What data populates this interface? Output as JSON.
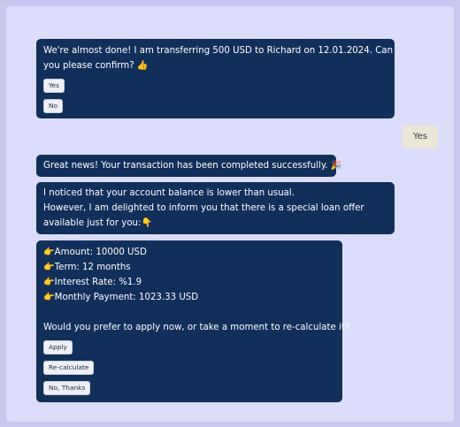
{
  "messages": {
    "m1": {
      "line1": "We're almost done! I am transferring 500 USD to Richard on 12.01.2024. Can",
      "line2": "you please confirm? 👍",
      "buttons": [
        "Yes",
        "No"
      ]
    },
    "user_reply": "Yes",
    "m2": {
      "text": "Great news! Your transaction has been completed successfully. 🎉"
    },
    "m3": {
      "line1": "I noticed that your account balance is lower than usual.",
      "line2": "However, I am delighted to inform you that there is a special loan offer",
      "line3": "available just for you:👇"
    },
    "m4": {
      "amount": "👉Amount: 10000 USD",
      "term": "👉Term: 12 months",
      "rate": "👉Interest Rate: %1.9",
      "payment": "👉Monthly Payment: 1023.33 USD",
      "question": "Would you prefer to apply now, or take a moment to re-calculate it?",
      "buttons": [
        "Apply",
        "Re-calculate",
        "No, Thanks"
      ]
    }
  }
}
